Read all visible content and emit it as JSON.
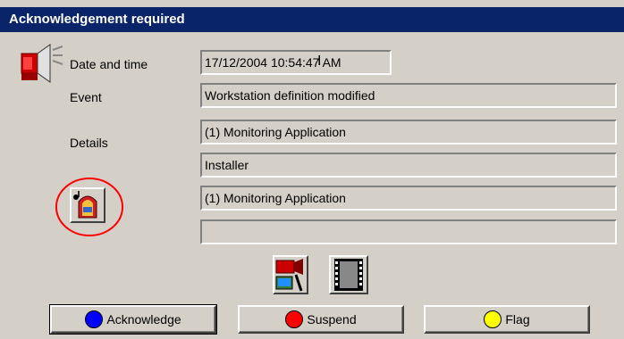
{
  "window": {
    "title": "Acknowledgement required"
  },
  "labels": {
    "date_time": "Date and time",
    "event": "Event",
    "details": "Details"
  },
  "fields": {
    "date_time": "17/12/2004 10:54:47 AM",
    "event": "Workstation definition modified",
    "details_1": "(1)  Monitoring Application",
    "details_2": "Installer",
    "details_3": "(1)  Monitoring Application",
    "details_4": ""
  },
  "buttons": {
    "acknowledge": {
      "label": "Acknowledge",
      "color": "#0000ff"
    },
    "suspend": {
      "label": "Suspend",
      "color": "#ff0000"
    },
    "flag": {
      "label": "Flag",
      "color": "#ffff00"
    }
  },
  "icons": {
    "alarm": "alarm-speaker-icon",
    "jukebox": "jukebox-sound-icon",
    "camera": "video-camera-icon",
    "film": "film-strip-icon"
  },
  "highlight_color": "#ff0000"
}
